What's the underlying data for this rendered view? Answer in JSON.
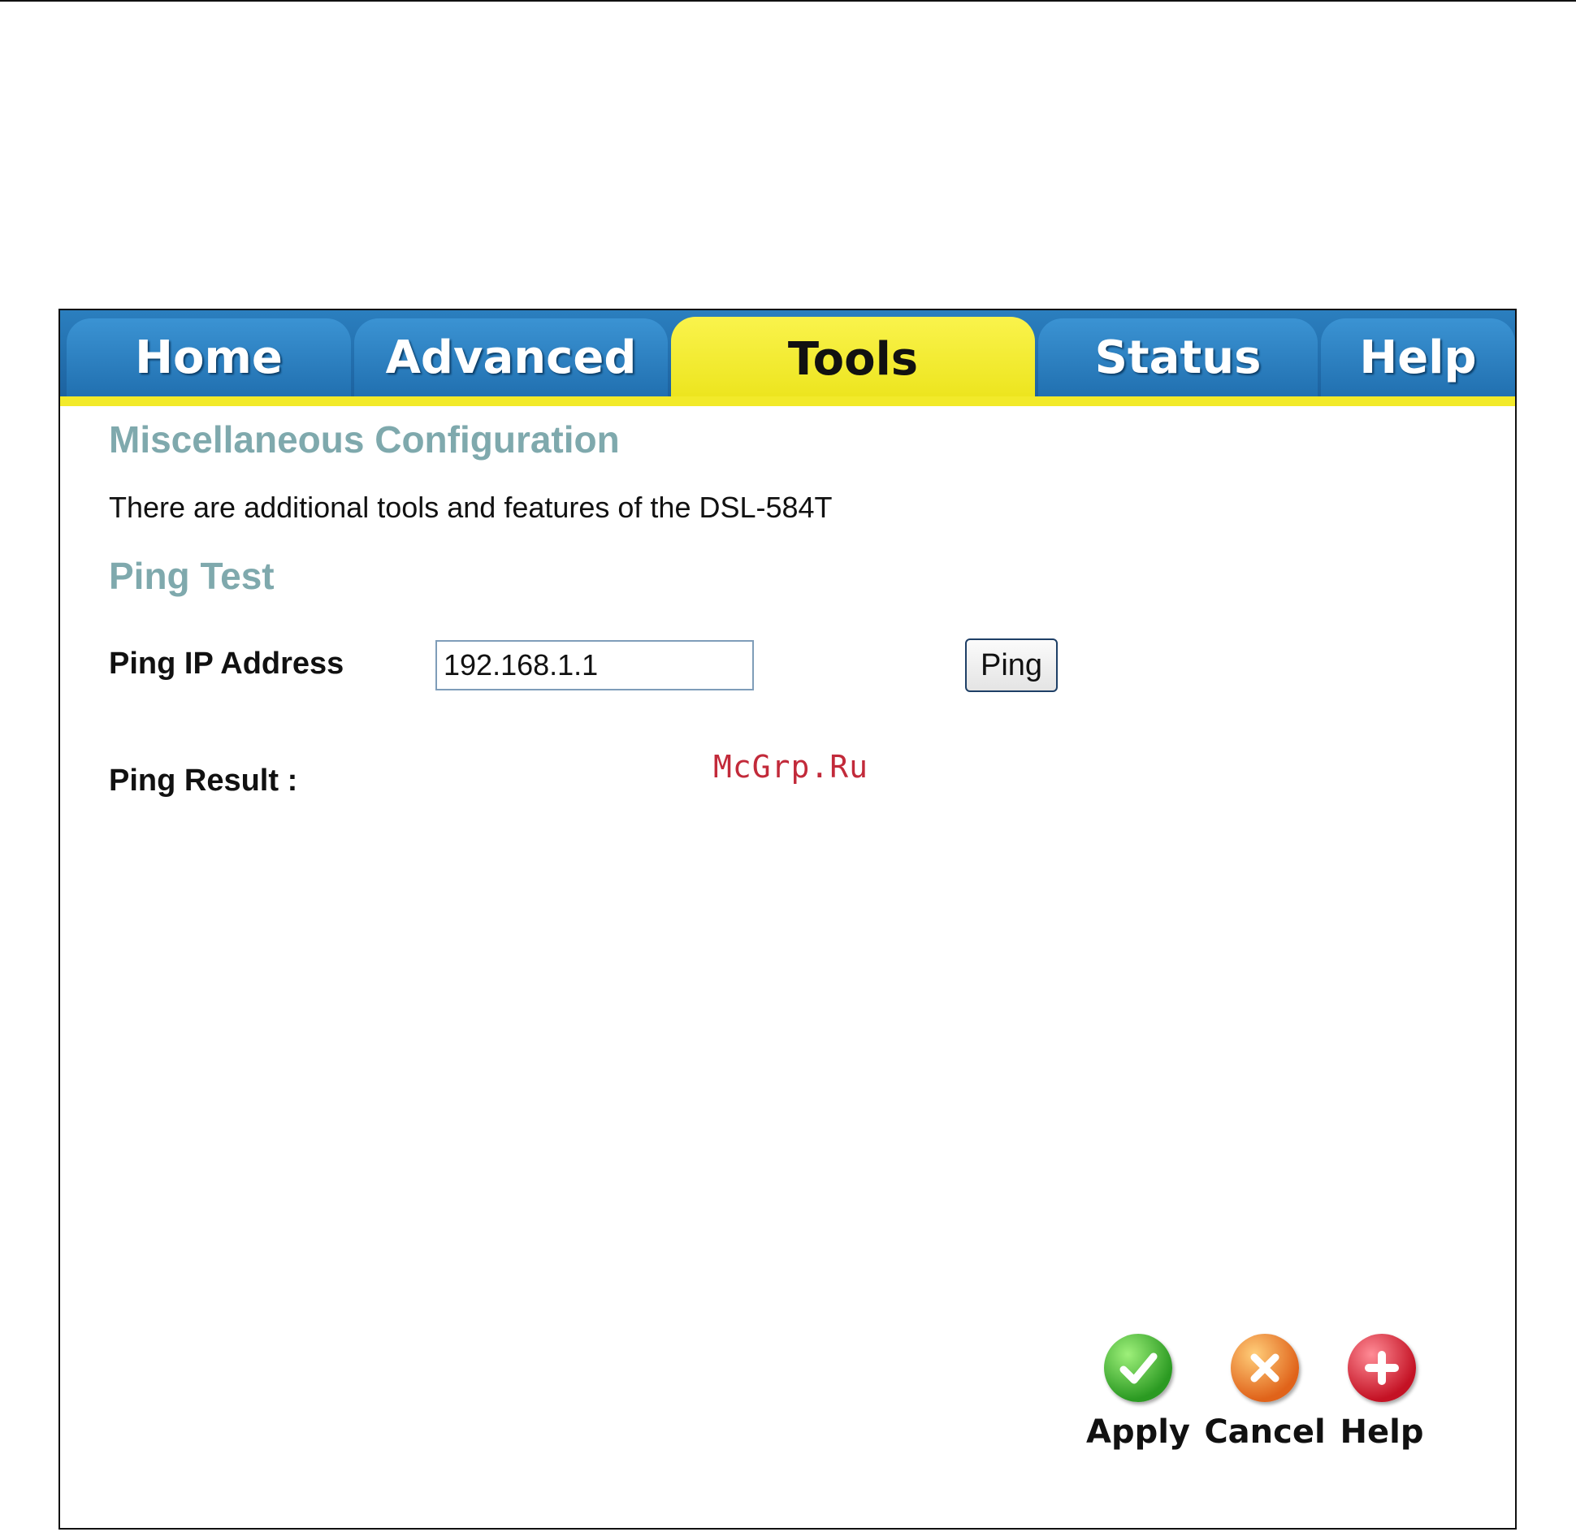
{
  "tabs": {
    "home": "Home",
    "advanced": "Advanced",
    "tools": "Tools",
    "status": "Status",
    "help": "Help"
  },
  "active_tab": "Tools",
  "main": {
    "section_title": "Miscellaneous Configuration",
    "description": "There are additional tools and features of the DSL-584T",
    "ping_section_title": "Ping Test",
    "ping_ip_label": "Ping IP Address",
    "ping_ip_value": "192.168.1.1",
    "ping_button": "Ping",
    "ping_result_label": "Ping Result :"
  },
  "watermark": "McGrp.Ru",
  "actions": {
    "apply": "Apply",
    "cancel": "Cancel",
    "help": "Help"
  },
  "colors": {
    "tab_blue": "#2170b0",
    "tab_active_yellow": "#f2ea2a",
    "section_title": "#7fa9ad",
    "apply_green": "#2b9a22",
    "cancel_orange": "#e0631a",
    "help_red": "#c41224"
  }
}
